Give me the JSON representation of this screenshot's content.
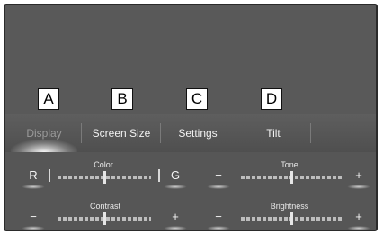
{
  "callouts": [
    "A",
    "B",
    "C",
    "D"
  ],
  "tabs": [
    {
      "label": "Display",
      "selected": true
    },
    {
      "label": "Screen Size",
      "selected": false
    },
    {
      "label": "Settings",
      "selected": false
    },
    {
      "label": "Tilt",
      "selected": false
    }
  ],
  "controls": {
    "color": {
      "label": "Color",
      "left_button": "R",
      "right_button": "G",
      "level": 0.5
    },
    "tone": {
      "label": "Tone",
      "left_button": "−",
      "right_button": "+",
      "level": 0.5
    },
    "contrast": {
      "label": "Contrast",
      "left_button": "−",
      "right_button": "+",
      "level": 0.5
    },
    "brightness": {
      "label": "Brightness",
      "left_button": "−",
      "right_button": "+",
      "level": 0.5
    }
  }
}
